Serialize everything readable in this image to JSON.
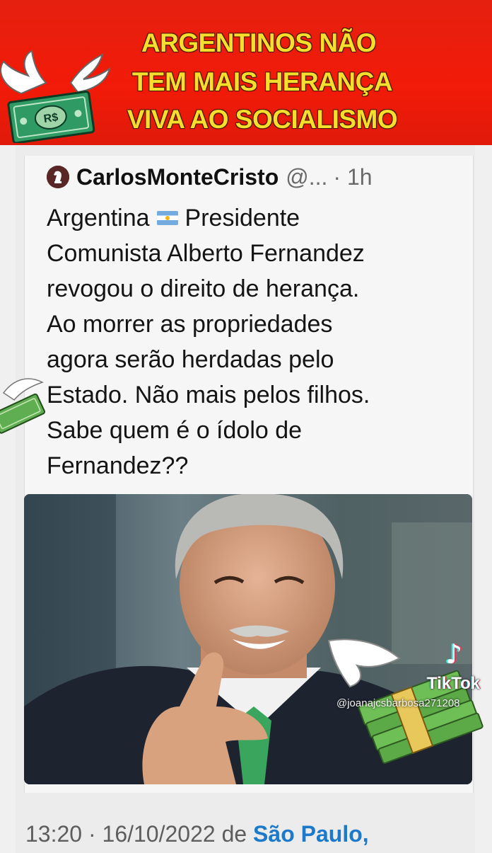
{
  "banner": {
    "line1": "ARGENTINOS NÃO",
    "line2": "TEM MAIS HERANÇA",
    "line3": "VIVA AO SOCIALISMO",
    "bill_label": "R$",
    "background_color": "#f21a08",
    "text_color": "#f6de2c"
  },
  "tweet": {
    "author_name": "CarlosMonteCristo",
    "author_handle": "@...",
    "time": "· 1h",
    "text_lines": [
      "Argentina",
      "Presidente",
      "Comunista Alberto Fernandez",
      "revogou o direito de herança.",
      "Ao morrer as propriedades",
      "agora serão herdadas pelo",
      "Estado. Não mais pelos filhos.",
      "Sabe quem é o ídolo de",
      "Fernandez??"
    ],
    "flag_icon": "argentina-flag-icon",
    "image_icon": "person-photo"
  },
  "watermark": {
    "logo_icon": "tiktok-icon",
    "brand": "TikTok",
    "username": "@joanajcsbarbosa271208"
  },
  "footer": {
    "time": "13:20 · 16/10/2022",
    "from": "de",
    "place": "São Paulo,"
  }
}
